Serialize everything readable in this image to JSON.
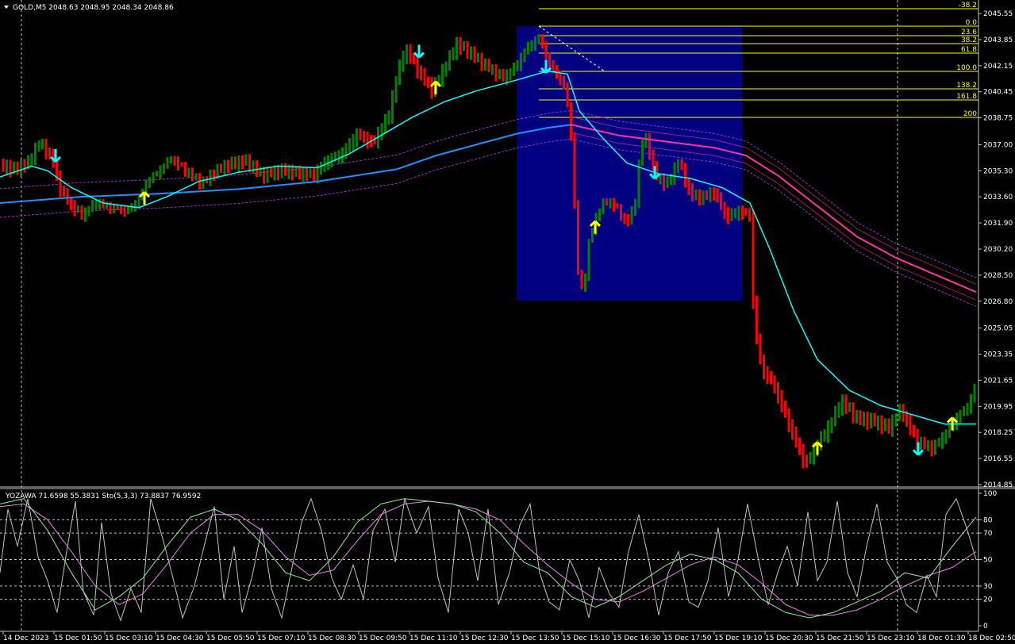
{
  "window": {
    "symbol_header": "GOLD,M5  2048.63 2048.95 2048.34 2048.86",
    "indicator_header": "YOZAWA 71.6598 55.3831  Sto(5,3,3) 73.8837 76.9592"
  },
  "colors": {
    "background": "#000000",
    "grid": "#c0c0c0",
    "bull_bar": "#008000",
    "bear_bar": "#ff0000",
    "fib_line": "#ffff00",
    "rect_fill": "#000080",
    "fast_ma": "#00ffff",
    "mid_ma": "#1e90ff",
    "slow_ma": "#ff3399",
    "envelope": "#9932cc",
    "buy_arrow": "#ffff00",
    "sell_arrow": "#00ffff",
    "osc_main": "#c0c0c0",
    "osc_k": "#90ee90",
    "osc_d": "#ee82ee"
  },
  "price_axis": {
    "ticks": [
      "2045.55",
      "2043.85",
      "2042.15",
      "2040.45",
      "2038.75",
      "2037.00",
      "2035.30",
      "2033.60",
      "2031.90",
      "2030.20",
      "2028.50",
      "2026.80",
      "2025.05",
      "2023.35",
      "2021.65",
      "2019.95",
      "2018.25",
      "2016.55",
      "2014.85"
    ]
  },
  "osc_axis": {
    "ticks": [
      "100",
      "80",
      "70",
      "50",
      "30",
      "20",
      "0"
    ]
  },
  "time_axis": {
    "labels": [
      "14 Dec 2023",
      "15 Dec 01:50",
      "15 Dec 03:10",
      "15 Dec 04:30",
      "15 Dec 05:50",
      "15 Dec 07:10",
      "15 Dec 08:30",
      "15 Dec 09:50",
      "15 Dec 11:10",
      "15 Dec 12:30",
      "15 Dec 13:50",
      "15 Dec 15:10",
      "15 Dec 16:30",
      "15 Dec 17:50",
      "15 Dec 19:10",
      "15 Dec 20:30",
      "15 Dec 21:50",
      "15 Dec 23:10",
      "18 Dec 01:30",
      "18 Dec 02:50"
    ]
  },
  "fibonacci": {
    "levels": [
      "-38.2",
      "0.0",
      "23.6",
      "38.2",
      "61.8",
      "100.0",
      "138.2",
      "161.8",
      "200"
    ]
  },
  "chart_data": {
    "type": "candlestick",
    "symbol": "GOLD",
    "timeframe": "M5",
    "last_bar": {
      "open": 2048.63,
      "high": 2048.95,
      "low": 2048.34,
      "close": 2048.86
    },
    "price_range": [
      2014.5,
      2046.3
    ],
    "osc_range": [
      0,
      100
    ],
    "osc_levels": [
      80,
      70,
      50,
      30,
      20
    ],
    "price_path": [
      [
        0,
        2035.7
      ],
      [
        18,
        2035.5
      ],
      [
        35,
        2035.9
      ],
      [
        50,
        2037.3
      ],
      [
        65,
        2036.2
      ],
      [
        75,
        2034.3
      ],
      [
        90,
        2033.0
      ],
      [
        105,
        2032.4
      ],
      [
        120,
        2033.2
      ],
      [
        140,
        2032.8
      ],
      [
        160,
        2032.6
      ],
      [
        175,
        2033.4
      ],
      [
        185,
        2034.6
      ],
      [
        200,
        2035.3
      ],
      [
        215,
        2036.2
      ],
      [
        235,
        2035.4
      ],
      [
        255,
        2034.6
      ],
      [
        270,
        2035.4
      ],
      [
        290,
        2035.9
      ],
      [
        310,
        2036.0
      ],
      [
        330,
        2035.0
      ],
      [
        355,
        2035.2
      ],
      [
        375,
        2035.0
      ],
      [
        395,
        2034.8
      ],
      [
        410,
        2035.7
      ],
      [
        430,
        2036.2
      ],
      [
        450,
        2037.6
      ],
      [
        470,
        2037.1
      ],
      [
        490,
        2039.0
      ],
      [
        500,
        2041.5
      ],
      [
        510,
        2043.3
      ],
      [
        520,
        2042.6
      ],
      [
        530,
        2041.6
      ],
      [
        545,
        2040.6
      ],
      [
        560,
        2042.0
      ],
      [
        575,
        2043.5
      ],
      [
        590,
        2043.0
      ],
      [
        605,
        2042.3
      ],
      [
        620,
        2041.7
      ],
      [
        635,
        2041.2
      ],
      [
        650,
        2042.0
      ],
      [
        665,
        2043.3
      ],
      [
        680,
        2044.0
      ],
      [
        690,
        2042.5
      ],
      [
        700,
        2041.8
      ],
      [
        712,
        2040.9
      ],
      [
        720,
        2037.6
      ],
      [
        728,
        2029.0
      ],
      [
        735,
        2027.5
      ],
      [
        742,
        2030.8
      ],
      [
        750,
        2032.4
      ],
      [
        762,
        2033.6
      ],
      [
        775,
        2033.2
      ],
      [
        790,
        2032.0
      ],
      [
        800,
        2033.2
      ],
      [
        808,
        2037.2
      ],
      [
        815,
        2037.4
      ],
      [
        825,
        2035.0
      ],
      [
        840,
        2034.3
      ],
      [
        855,
        2035.8
      ],
      [
        870,
        2033.6
      ],
      [
        885,
        2033.4
      ],
      [
        900,
        2033.8
      ],
      [
        915,
        2032.2
      ],
      [
        930,
        2032.6
      ],
      [
        945,
        2032.4
      ],
      [
        950,
        2025.4
      ],
      [
        960,
        2022.4
      ],
      [
        975,
        2021.4
      ],
      [
        990,
        2019.4
      ],
      [
        1005,
        2017.4
      ],
      [
        1015,
        2016.2
      ],
      [
        1030,
        2017.5
      ],
      [
        1045,
        2018.6
      ],
      [
        1060,
        2020.2
      ],
      [
        1080,
        2019.0
      ],
      [
        1100,
        2018.8
      ],
      [
        1120,
        2018.4
      ],
      [
        1135,
        2019.6
      ],
      [
        1155,
        2017.6
      ],
      [
        1175,
        2017.2
      ],
      [
        1190,
        2018.1
      ],
      [
        1205,
        2019.3
      ],
      [
        1220,
        2020.1
      ],
      [
        1230,
        2021.6
      ]
    ],
    "fast_ma_path": [
      [
        0,
        2034.9
      ],
      [
        40,
        2035.6
      ],
      [
        60,
        2035.3
      ],
      [
        90,
        2034.2
      ],
      [
        130,
        2033.2
      ],
      [
        175,
        2032.9
      ],
      [
        210,
        2033.6
      ],
      [
        250,
        2034.6
      ],
      [
        300,
        2035.2
      ],
      [
        350,
        2035.6
      ],
      [
        400,
        2035.5
      ],
      [
        440,
        2036.4
      ],
      [
        480,
        2037.6
      ],
      [
        520,
        2038.8
      ],
      [
        560,
        2039.8
      ],
      [
        600,
        2040.5
      ],
      [
        650,
        2041.2
      ],
      [
        690,
        2041.8
      ],
      [
        715,
        2041.6
      ],
      [
        730,
        2039.2
      ],
      [
        760,
        2037.4
      ],
      [
        790,
        2035.8
      ],
      [
        830,
        2035.1
      ],
      [
        870,
        2034.8
      ],
      [
        910,
        2034.2
      ],
      [
        945,
        2033.2
      ],
      [
        970,
        2030.2
      ],
      [
        1000,
        2026.2
      ],
      [
        1030,
        2023.0
      ],
      [
        1070,
        2021.0
      ],
      [
        1110,
        2020.0
      ],
      [
        1150,
        2019.4
      ],
      [
        1190,
        2018.8
      ],
      [
        1230,
        2018.8
      ]
    ],
    "mid_ma_path": [
      [
        0,
        2033.2
      ],
      [
        100,
        2033.6
      ],
      [
        200,
        2033.8
      ],
      [
        300,
        2034.1
      ],
      [
        400,
        2034.6
      ],
      [
        500,
        2035.4
      ],
      [
        550,
        2036.3
      ],
      [
        600,
        2037.0
      ],
      [
        650,
        2037.7
      ],
      [
        690,
        2038.1
      ],
      [
        720,
        2038.3
      ]
    ],
    "slow_ma_path": [
      [
        720,
        2038.3
      ],
      [
        780,
        2037.6
      ],
      [
        840,
        2037.2
      ],
      [
        900,
        2036.8
      ],
      [
        940,
        2036.3
      ],
      [
        980,
        2035.0
      ],
      [
        1030,
        2033.0
      ],
      [
        1080,
        2031.0
      ],
      [
        1130,
        2029.6
      ],
      [
        1180,
        2028.5
      ],
      [
        1230,
        2027.4
      ]
    ],
    "sell_arrows": [
      [
        70,
        2036.3
      ],
      [
        528,
        2043.1
      ],
      [
        688,
        2042.1
      ],
      [
        825,
        2035.2
      ],
      [
        1157,
        2017.2
      ]
    ],
    "buy_arrows": [
      [
        182,
        2033.5
      ],
      [
        549,
        2040.7
      ],
      [
        750,
        2031.6
      ],
      [
        1030,
        2017.2
      ],
      [
        1200,
        2018.8
      ]
    ],
    "osc_main": [
      [
        0,
        40
      ],
      [
        10,
        88
      ],
      [
        22,
        60
      ],
      [
        35,
        96
      ],
      [
        48,
        52
      ],
      [
        60,
        34
      ],
      [
        72,
        10
      ],
      [
        85,
        60
      ],
      [
        95,
        94
      ],
      [
        105,
        26
      ],
      [
        118,
        8
      ],
      [
        128,
        78
      ],
      [
        140,
        24
      ],
      [
        152,
        4
      ],
      [
        165,
        28
      ],
      [
        178,
        10
      ],
      [
        190,
        96
      ],
      [
        205,
        66
      ],
      [
        218,
        36
      ],
      [
        230,
        6
      ],
      [
        245,
        30
      ],
      [
        258,
        62
      ],
      [
        270,
        90
      ],
      [
        282,
        20
      ],
      [
        295,
        60
      ],
      [
        305,
        10
      ],
      [
        318,
        38
      ],
      [
        330,
        74
      ],
      [
        342,
        28
      ],
      [
        355,
        6
      ],
      [
        368,
        44
      ],
      [
        380,
        78
      ],
      [
        392,
        96
      ],
      [
        405,
        72
      ],
      [
        418,
        36
      ],
      [
        430,
        20
      ],
      [
        445,
        46
      ],
      [
        458,
        20
      ],
      [
        470,
        72
      ],
      [
        485,
        88
      ],
      [
        498,
        48
      ],
      [
        510,
        96
      ],
      [
        525,
        70
      ],
      [
        540,
        90
      ],
      [
        552,
        36
      ],
      [
        565,
        10
      ],
      [
        578,
        88
      ],
      [
        590,
        70
      ],
      [
        602,
        34
      ],
      [
        615,
        88
      ],
      [
        628,
        16
      ],
      [
        642,
        40
      ],
      [
        655,
        76
      ],
      [
        668,
        92
      ],
      [
        680,
        40
      ],
      [
        692,
        18
      ],
      [
        705,
        12
      ],
      [
        718,
        50
      ],
      [
        730,
        34
      ],
      [
        742,
        6
      ],
      [
        755,
        44
      ],
      [
        768,
        24
      ],
      [
        780,
        14
      ],
      [
        792,
        56
      ],
      [
        805,
        84
      ],
      [
        818,
        48
      ],
      [
        830,
        8
      ],
      [
        842,
        40
      ],
      [
        855,
        56
      ],
      [
        868,
        18
      ],
      [
        880,
        14
      ],
      [
        892,
        34
      ],
      [
        905,
        74
      ],
      [
        918,
        22
      ],
      [
        930,
        50
      ],
      [
        942,
        92
      ],
      [
        955,
        52
      ],
      [
        968,
        16
      ],
      [
        980,
        40
      ],
      [
        992,
        60
      ],
      [
        1005,
        30
      ],
      [
        1018,
        86
      ],
      [
        1030,
        34
      ],
      [
        1042,
        48
      ],
      [
        1055,
        94
      ],
      [
        1068,
        40
      ],
      [
        1080,
        22
      ],
      [
        1092,
        60
      ],
      [
        1105,
        92
      ],
      [
        1118,
        48
      ],
      [
        1130,
        36
      ],
      [
        1142,
        16
      ],
      [
        1155,
        10
      ],
      [
        1168,
        38
      ],
      [
        1180,
        22
      ],
      [
        1192,
        84
      ],
      [
        1205,
        96
      ],
      [
        1218,
        74
      ],
      [
        1230,
        50
      ]
    ],
    "osc_k": [
      [
        0,
        92
      ],
      [
        30,
        96
      ],
      [
        60,
        72
      ],
      [
        90,
        40
      ],
      [
        120,
        12
      ],
      [
        150,
        22
      ],
      [
        180,
        36
      ],
      [
        210,
        60
      ],
      [
        240,
        82
      ],
      [
        270,
        88
      ],
      [
        300,
        80
      ],
      [
        330,
        62
      ],
      [
        360,
        40
      ],
      [
        390,
        34
      ],
      [
        420,
        52
      ],
      [
        450,
        78
      ],
      [
        480,
        92
      ],
      [
        510,
        96
      ],
      [
        540,
        94
      ],
      [
        570,
        92
      ],
      [
        600,
        86
      ],
      [
        630,
        70
      ],
      [
        660,
        48
      ],
      [
        690,
        40
      ],
      [
        720,
        22
      ],
      [
        750,
        14
      ],
      [
        780,
        22
      ],
      [
        810,
        34
      ],
      [
        840,
        46
      ],
      [
        870,
        54
      ],
      [
        900,
        50
      ],
      [
        930,
        40
      ],
      [
        960,
        20
      ],
      [
        990,
        10
      ],
      [
        1020,
        6
      ],
      [
        1050,
        10
      ],
      [
        1080,
        18
      ],
      [
        1110,
        26
      ],
      [
        1140,
        40
      ],
      [
        1170,
        36
      ],
      [
        1200,
        60
      ],
      [
        1230,
        82
      ]
    ],
    "osc_d": [
      [
        0,
        90
      ],
      [
        30,
        92
      ],
      [
        60,
        80
      ],
      [
        90,
        56
      ],
      [
        120,
        30
      ],
      [
        150,
        16
      ],
      [
        180,
        24
      ],
      [
        210,
        46
      ],
      [
        240,
        70
      ],
      [
        270,
        84
      ],
      [
        300,
        84
      ],
      [
        330,
        72
      ],
      [
        360,
        52
      ],
      [
        390,
        38
      ],
      [
        420,
        42
      ],
      [
        450,
        64
      ],
      [
        480,
        84
      ],
      [
        510,
        92
      ],
      [
        540,
        94
      ],
      [
        570,
        92
      ],
      [
        600,
        88
      ],
      [
        630,
        80
      ],
      [
        660,
        62
      ],
      [
        690,
        46
      ],
      [
        720,
        32
      ],
      [
        750,
        20
      ],
      [
        780,
        18
      ],
      [
        810,
        26
      ],
      [
        840,
        36
      ],
      [
        870,
        46
      ],
      [
        900,
        52
      ],
      [
        930,
        46
      ],
      [
        960,
        32
      ],
      [
        990,
        16
      ],
      [
        1020,
        8
      ],
      [
        1050,
        8
      ],
      [
        1080,
        12
      ],
      [
        1110,
        20
      ],
      [
        1140,
        30
      ],
      [
        1170,
        38
      ],
      [
        1200,
        44
      ],
      [
        1230,
        56
      ]
    ]
  }
}
